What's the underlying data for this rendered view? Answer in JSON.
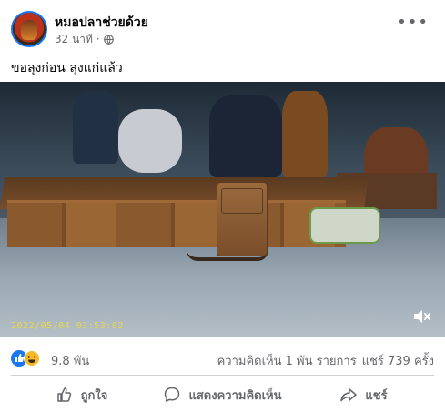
{
  "post": {
    "page_name": "หมอปลาช่วยด้วย",
    "time": "32 นาที ·",
    "text": "ขอลุงก่อน ลุงแก่แล้ว",
    "more_icon": "more-dots-icon",
    "privacy_icon": "globe-icon"
  },
  "video": {
    "timestamp": "2022/05/04  03:53:02",
    "mute_icon": "speaker-muted-icon"
  },
  "engagement": {
    "reaction_count": "9.8 พัน",
    "comments": "ความคิดเห็น 1 พัน รายการ",
    "shares": "แชร์ 739 ครั้ง",
    "reaction_icons": [
      "like-icon",
      "haha-icon"
    ]
  },
  "actions": {
    "like": "ถูกใจ",
    "comment": "แสดงความคิดเห็น",
    "share": "แชร์"
  },
  "colors": {
    "facebook_blue": "#1877f2",
    "secondary_text": "#65676b",
    "haha_yellow": "#f7b928"
  }
}
